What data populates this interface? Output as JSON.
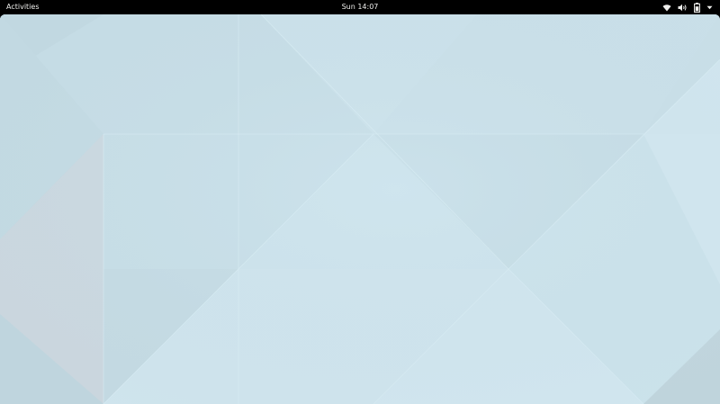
{
  "top_bar": {
    "activities_label": "Activities",
    "clock_text": "Sun 14:07",
    "status_icons": [
      "wifi-icon",
      "volume-icon",
      "battery-icon",
      "system-menu-arrow-icon"
    ]
  },
  "desktop": {
    "wallpaper": "geometric-triangles-light-blue",
    "colors": {
      "base": "#c7dde6",
      "light": "#d3e7ef",
      "mid": "#c2d9e2",
      "dark": "#b6cdd6",
      "pink": "#cfd6dd"
    }
  }
}
